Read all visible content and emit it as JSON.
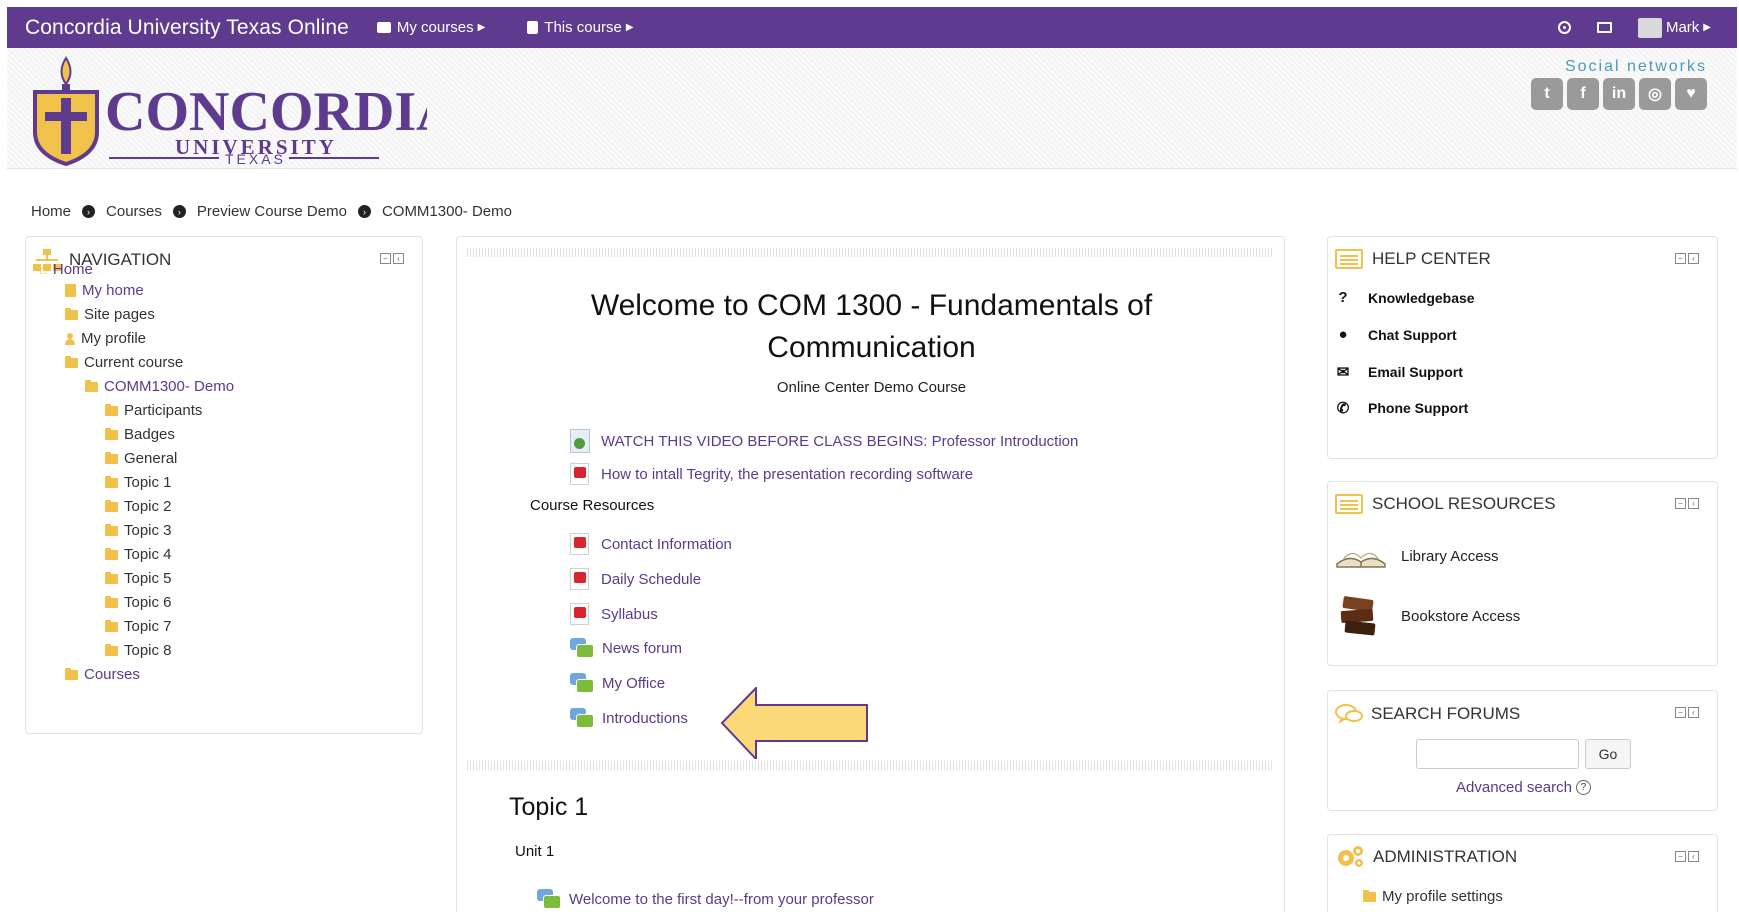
{
  "topbar": {
    "brand": "Concordia University Texas Online",
    "my_courses": "My courses",
    "this_course": "This course",
    "user": "Mark"
  },
  "header": {
    "logo_text": "CONCORDIA",
    "logo_sub": "UNIVERSITY",
    "logo_state": "TEXAS",
    "social_title": "Social networks",
    "social_icons": [
      "twitter-icon",
      "facebook-icon",
      "linkedin-icon",
      "instagram-icon",
      "pinterest-icon"
    ]
  },
  "breadcrumb": [
    "Home",
    "Courses",
    "Preview Course Demo",
    "COMM1300- Demo"
  ],
  "navigation": {
    "title": "NAVIGATION",
    "items": [
      {
        "label": "Home",
        "icon": "home"
      },
      {
        "label": "My home",
        "icon": "file"
      },
      {
        "label": "Site pages",
        "icon": "folder"
      },
      {
        "label": "My profile",
        "icon": "person"
      },
      {
        "label": "Current course",
        "icon": "folder-open"
      },
      {
        "label": "COMM1300- Demo",
        "icon": "folder-open"
      },
      {
        "label": "Participants",
        "icon": "folder"
      },
      {
        "label": "Badges",
        "icon": "folder"
      },
      {
        "label": "General",
        "icon": "folder"
      },
      {
        "label": "Topic 1",
        "icon": "folder"
      },
      {
        "label": "Topic 2",
        "icon": "folder"
      },
      {
        "label": "Topic 3",
        "icon": "folder"
      },
      {
        "label": "Topic 4",
        "icon": "folder"
      },
      {
        "label": "Topic 5",
        "icon": "folder"
      },
      {
        "label": "Topic 6",
        "icon": "folder"
      },
      {
        "label": "Topic 7",
        "icon": "folder"
      },
      {
        "label": "Topic 8",
        "icon": "folder"
      },
      {
        "label": "Courses",
        "icon": "folder"
      }
    ]
  },
  "main": {
    "title_line1": "Welcome to COM 1300 - Fundamentals of",
    "title_line2": "Communication",
    "subtitle": "Online Center Demo Course",
    "video_link": "WATCH THIS VIDEO BEFORE CLASS BEGINS: Professor Introduction",
    "tegrity_link": "How to intall Tegrity, the presentation recording software",
    "resources_label": "Course Resources",
    "resources": [
      {
        "label": "Contact Information",
        "type": "pdf"
      },
      {
        "label": "Daily Schedule",
        "type": "pdf"
      },
      {
        "label": "Syllabus",
        "type": "pdf"
      },
      {
        "label": "News forum",
        "type": "forum"
      },
      {
        "label": "My Office",
        "type": "forum"
      },
      {
        "label": "Introductions",
        "type": "forum"
      }
    ],
    "topic1_title": "Topic 1",
    "unit1": "Unit 1",
    "topic1_link": "Welcome to the first day!--from your professor"
  },
  "help_center": {
    "title": "HELP CENTER",
    "items": [
      "Knowledgebase",
      "Chat Support",
      "Email Support",
      "Phone Support"
    ]
  },
  "school_resources": {
    "title": "SCHOOL RESOURCES",
    "items": [
      "Library Access",
      "Bookstore Access"
    ]
  },
  "search_forums": {
    "title": "SEARCH FORUMS",
    "go": "Go",
    "advanced": "Advanced search"
  },
  "administration": {
    "title": "ADMINISTRATION",
    "item": "My profile settings"
  },
  "colors": {
    "brand_purple": "#5e3b8f",
    "accent_gold": "#f0c14b",
    "link": "#5b3b8a"
  }
}
